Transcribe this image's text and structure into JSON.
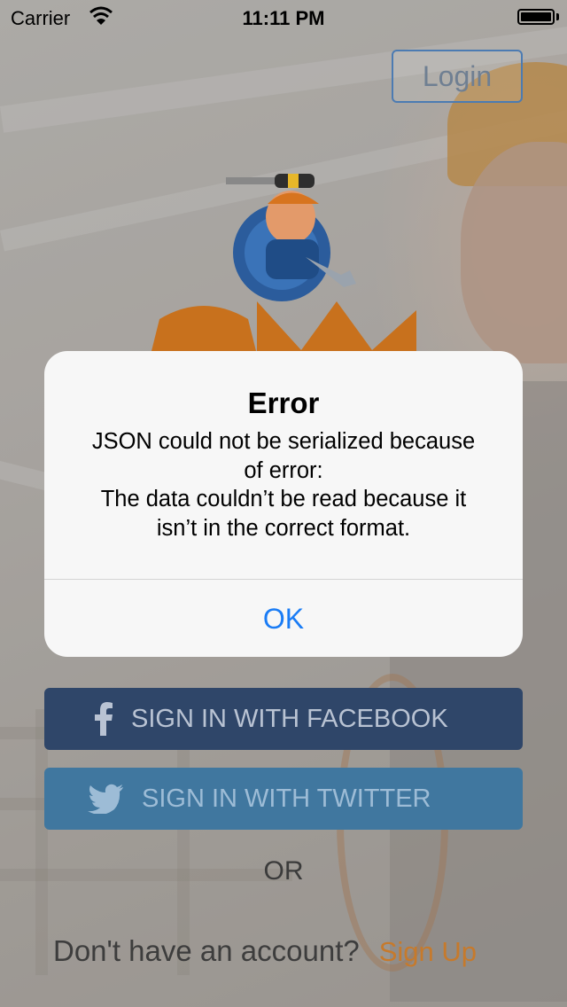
{
  "status_bar": {
    "carrier": "Carrier",
    "time": "11:11 PM"
  },
  "header": {
    "login_label": "Login"
  },
  "alert": {
    "title": "Error",
    "message_lines": [
      "JSON could not be serialized because",
      "of error:",
      "The data couldn’t be read because it",
      "isn’t in the correct format."
    ],
    "ok_label": "OK"
  },
  "social": {
    "facebook_label": "SIGN IN WITH FACEBOOK",
    "facebook_icon": "facebook-icon",
    "twitter_label": "SIGN IN WITH TWITTER",
    "twitter_icon": "twitter-icon"
  },
  "or_label": "OR",
  "footer": {
    "prompt": "Don't have an account?",
    "signup_label": "Sign Up"
  },
  "colors": {
    "facebook": "#2f4669",
    "twitter": "#40779f",
    "signup": "#c67a2c",
    "alert_button": "#1a7cf5"
  }
}
